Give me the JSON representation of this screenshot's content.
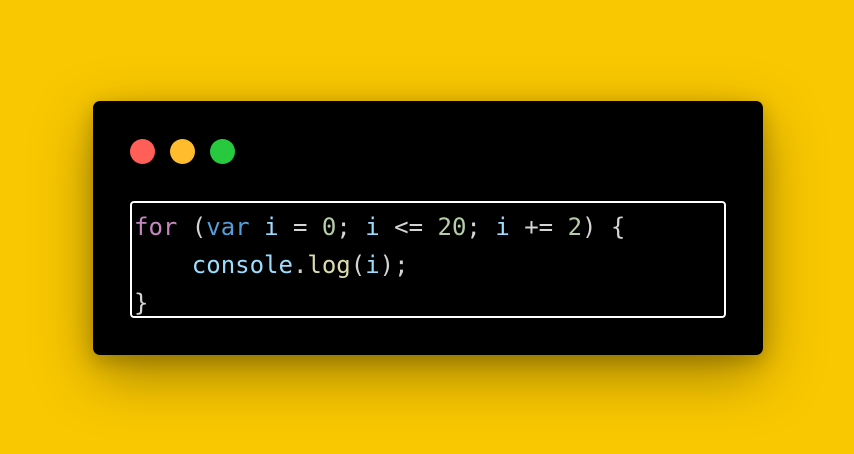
{
  "colors": {
    "background": "#FAC801",
    "window": "#000000",
    "dot_close": "#FF5F56",
    "dot_minimize": "#FFBD2E",
    "dot_maximize": "#27C93F",
    "keyword": "#C586C0",
    "storage": "#569CD6",
    "variable": "#9CDCFE",
    "number": "#B5CEA8",
    "function": "#DCDCAA",
    "punctuation": "#d4d4d4"
  },
  "code": {
    "lines": [
      [
        {
          "text": "for",
          "type": "keyword"
        },
        {
          "text": " (",
          "type": "punct"
        },
        {
          "text": "var",
          "type": "storage"
        },
        {
          "text": " ",
          "type": "punct"
        },
        {
          "text": "i",
          "type": "var"
        },
        {
          "text": " = ",
          "type": "punct"
        },
        {
          "text": "0",
          "type": "num"
        },
        {
          "text": "; ",
          "type": "punct"
        },
        {
          "text": "i",
          "type": "var"
        },
        {
          "text": " <= ",
          "type": "punct"
        },
        {
          "text": "20",
          "type": "num"
        },
        {
          "text": "; ",
          "type": "punct"
        },
        {
          "text": "i",
          "type": "var"
        },
        {
          "text": " += ",
          "type": "punct"
        },
        {
          "text": "2",
          "type": "num"
        },
        {
          "text": ") {",
          "type": "punct"
        }
      ],
      [
        {
          "text": "    ",
          "type": "punct"
        },
        {
          "text": "console",
          "type": "var"
        },
        {
          "text": ".",
          "type": "punct"
        },
        {
          "text": "log",
          "type": "fn"
        },
        {
          "text": "(",
          "type": "punct"
        },
        {
          "text": "i",
          "type": "var"
        },
        {
          "text": ");",
          "type": "punct"
        }
      ],
      [
        {
          "text": "}",
          "type": "punct"
        }
      ]
    ]
  }
}
